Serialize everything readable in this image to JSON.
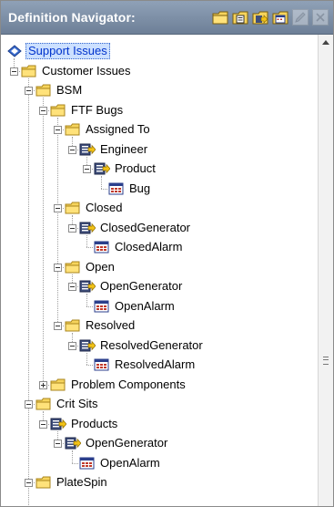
{
  "header": {
    "title": "Definition Navigator:",
    "toolbar": [
      {
        "name": "new-folder-icon",
        "enabled": true
      },
      {
        "name": "new-view-icon",
        "enabled": true
      },
      {
        "name": "new-generator-icon",
        "enabled": true
      },
      {
        "name": "new-alarm-icon",
        "enabled": true
      },
      {
        "name": "edit-icon",
        "enabled": false
      },
      {
        "name": "delete-icon",
        "enabled": false
      }
    ]
  },
  "tree": {
    "nodes": [
      {
        "label": "Support Issues",
        "icon": "root-icon",
        "level": 0,
        "selected": true
      },
      {
        "label": "Customer Issues",
        "icon": "folder-icon",
        "level": 1
      },
      {
        "label": "BSM",
        "icon": "folder-icon",
        "level": 2
      },
      {
        "label": "FTF Bugs",
        "icon": "folder-icon",
        "level": 3
      },
      {
        "label": "Assigned To",
        "icon": "folder-icon",
        "level": 4
      },
      {
        "label": "Engineer",
        "icon": "generator-icon",
        "level": 5
      },
      {
        "label": "Product",
        "icon": "generator-icon",
        "level": 6
      },
      {
        "label": "Bug",
        "icon": "alarm-icon",
        "level": 7
      },
      {
        "label": "Closed",
        "icon": "folder-icon",
        "level": 4
      },
      {
        "label": "ClosedGenerator",
        "icon": "generator-icon",
        "level": 5
      },
      {
        "label": "ClosedAlarm",
        "icon": "alarm-icon",
        "level": 6
      },
      {
        "label": "Open",
        "icon": "folder-icon",
        "level": 4
      },
      {
        "label": "OpenGenerator",
        "icon": "generator-icon",
        "level": 5
      },
      {
        "label": "OpenAlarm",
        "icon": "alarm-icon",
        "level": 6
      },
      {
        "label": "Resolved",
        "icon": "folder-icon",
        "level": 4
      },
      {
        "label": "ResolvedGenerator",
        "icon": "generator-icon",
        "level": 5
      },
      {
        "label": "ResolvedAlarm",
        "icon": "alarm-icon",
        "level": 6
      },
      {
        "label": "Problem Components",
        "icon": "folder-icon",
        "level": 3,
        "collapsed": true
      },
      {
        "label": "Crit Sits",
        "icon": "folder-icon",
        "level": 2
      },
      {
        "label": "Products",
        "icon": "generator-icon",
        "level": 3
      },
      {
        "label": "OpenGenerator",
        "icon": "generator-icon",
        "level": 4
      },
      {
        "label": "OpenAlarm",
        "icon": "alarm-icon",
        "level": 5
      },
      {
        "label": "PlateSpin",
        "icon": "folder-icon",
        "level": 2
      }
    ]
  }
}
